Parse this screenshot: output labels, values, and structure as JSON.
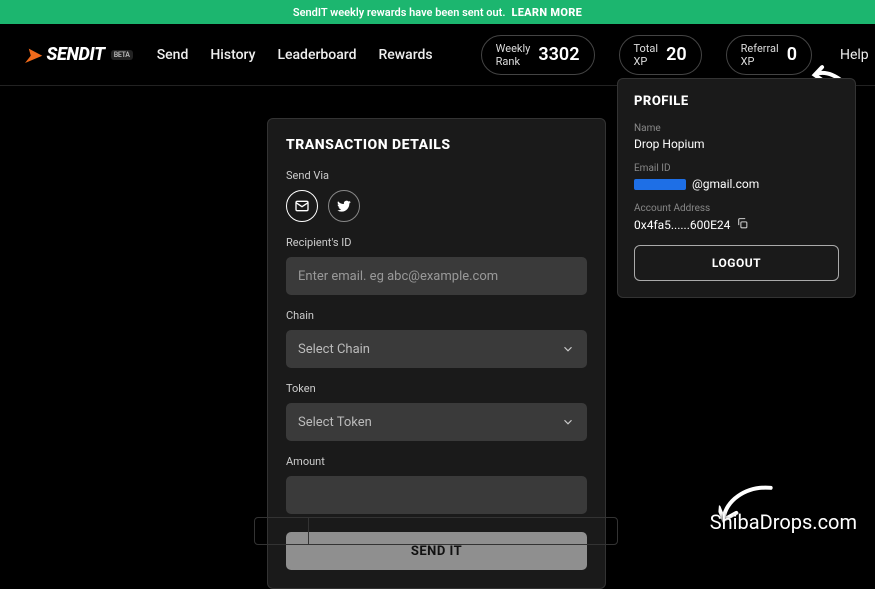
{
  "banner": {
    "text": "SendIT weekly rewards have been sent out.",
    "learn": "LEARN MORE"
  },
  "logo": {
    "text": "SENDIT",
    "badge": "BETA"
  },
  "nav": {
    "send": "Send",
    "history": "History",
    "leaderboard": "Leaderboard",
    "rewards": "Rewards"
  },
  "pills": {
    "rank_label": "Weekly Rank",
    "rank_value": "3302",
    "xp_label": "Total XP",
    "xp_value": "20",
    "ref_label": "Referral XP",
    "ref_value": "0"
  },
  "help": "Help",
  "card": {
    "title": "TRANSACTION DETAILS",
    "send_via": "Send Via",
    "recipient_label": "Recipient's ID",
    "recipient_placeholder": "Enter email. eg abc@example.com",
    "chain_label": "Chain",
    "chain_placeholder": "Select Chain",
    "token_label": "Token",
    "token_placeholder": "Select Token",
    "amount_label": "Amount",
    "submit": "SEND IT"
  },
  "profile": {
    "title": "PROFILE",
    "name_label": "Name",
    "name_value": "Drop Hopium",
    "email_label": "Email ID",
    "email_suffix": "@gmail.com",
    "addr_label": "Account Address",
    "addr_value": "0x4fa5......600E24",
    "logout": "LOGOUT"
  },
  "watermark": "ShibaDrops.com"
}
